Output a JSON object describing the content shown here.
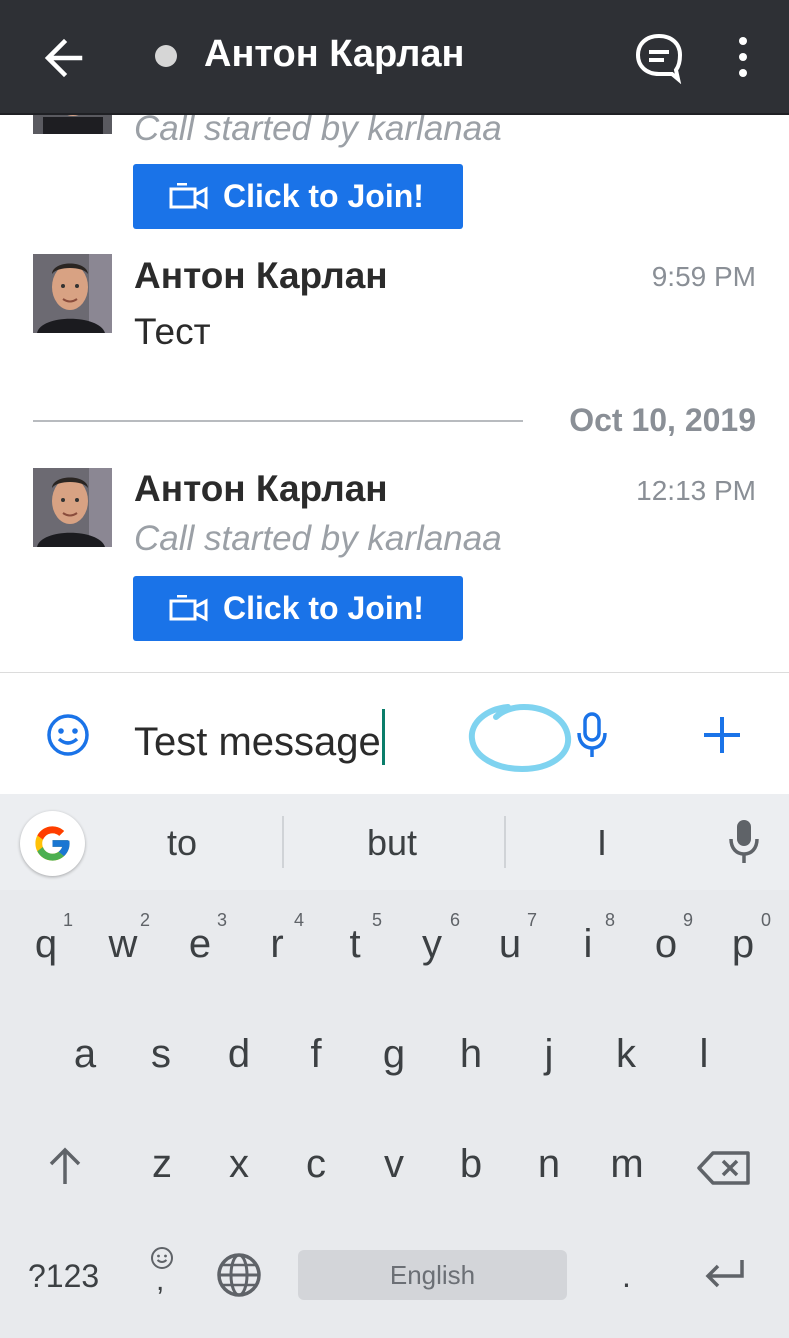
{
  "header": {
    "title": "Антон Карлан"
  },
  "messages": {
    "top_partial": {
      "subtitle": "Call started by karlanaa",
      "join_label": "Click to Join!"
    },
    "msg1": {
      "sender": "Антон Карлан",
      "time": "9:59 PM",
      "text": "Тест"
    },
    "date_divider": "Oct 10, 2019",
    "msg2": {
      "sender": "Антон Карлан",
      "time": "12:13 PM",
      "subtitle": "Call started by karlanaa",
      "join_label": "Click to Join!"
    }
  },
  "composer": {
    "text": "Test message"
  },
  "keyboard": {
    "suggestions": [
      "to",
      "but",
      "I"
    ],
    "row1": [
      "q",
      "w",
      "e",
      "r",
      "t",
      "y",
      "u",
      "i",
      "o",
      "p"
    ],
    "row1_hints": [
      "1",
      "2",
      "3",
      "4",
      "5",
      "6",
      "7",
      "8",
      "9",
      "0"
    ],
    "row2": [
      "a",
      "s",
      "d",
      "f",
      "g",
      "h",
      "j",
      "k",
      "l"
    ],
    "row3": [
      "z",
      "x",
      "c",
      "v",
      "b",
      "n",
      "m"
    ],
    "symbols_label": "?123",
    "comma_label": ",",
    "space_label": "English",
    "period_label": "."
  },
  "colors": {
    "appbar": "#2e3035",
    "accent": "#1a73e8",
    "scribble": "#7fd3f0"
  }
}
